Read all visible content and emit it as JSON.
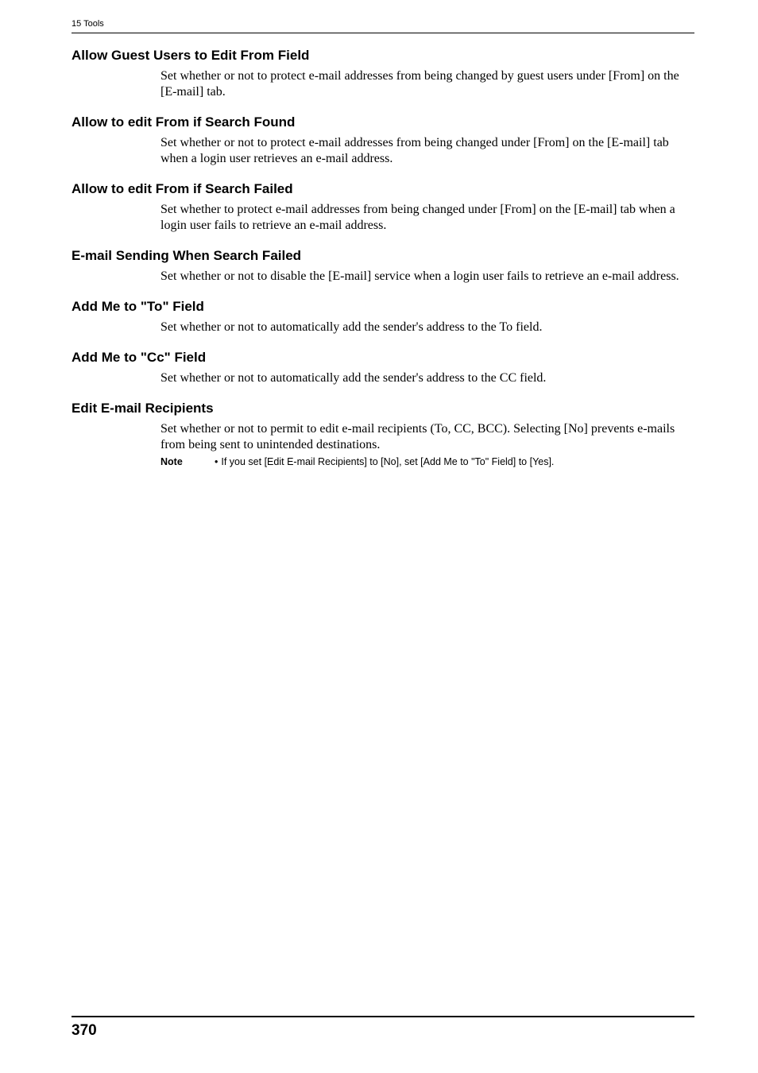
{
  "header": {
    "chapter": "15 Tools"
  },
  "sections": [
    {
      "heading": "Allow Guest Users to Edit From Field",
      "body": "Set whether or not to protect e-mail addresses from being changed by guest users under [From] on the [E-mail] tab."
    },
    {
      "heading": "Allow to edit From if Search Found",
      "body": "Set whether or not to protect e-mail addresses from being changed under [From] on the [E-mail] tab when a login user retrieves an e-mail address."
    },
    {
      "heading": "Allow to edit From if Search Failed",
      "body": "Set whether to protect e-mail addresses from being changed under [From] on the [E-mail] tab when a login user fails to retrieve an e-mail address."
    },
    {
      "heading": "E-mail Sending When Search Failed",
      "body": "Set whether or not to disable the [E-mail] service when a login user fails to retrieve an e-mail address."
    },
    {
      "heading": "Add Me to \"To\" Field",
      "body": "Set whether or not to automatically add the sender's address to the To field."
    },
    {
      "heading": "Add Me to \"Cc\" Field",
      "body": "Set whether or not to automatically add the sender's address to the CC field."
    },
    {
      "heading": "Edit E-mail Recipients",
      "body": "Set whether or not to permit to edit e-mail recipients (To, CC, BCC). Selecting [No] prevents e-mails from being sent to unintended destinations.",
      "note": {
        "label": "Note",
        "text": "If you set [Edit E-mail Recipients] to [No], set [Add Me to \"To\" Field] to [Yes]."
      }
    }
  ],
  "footer": {
    "page_number": "370"
  }
}
